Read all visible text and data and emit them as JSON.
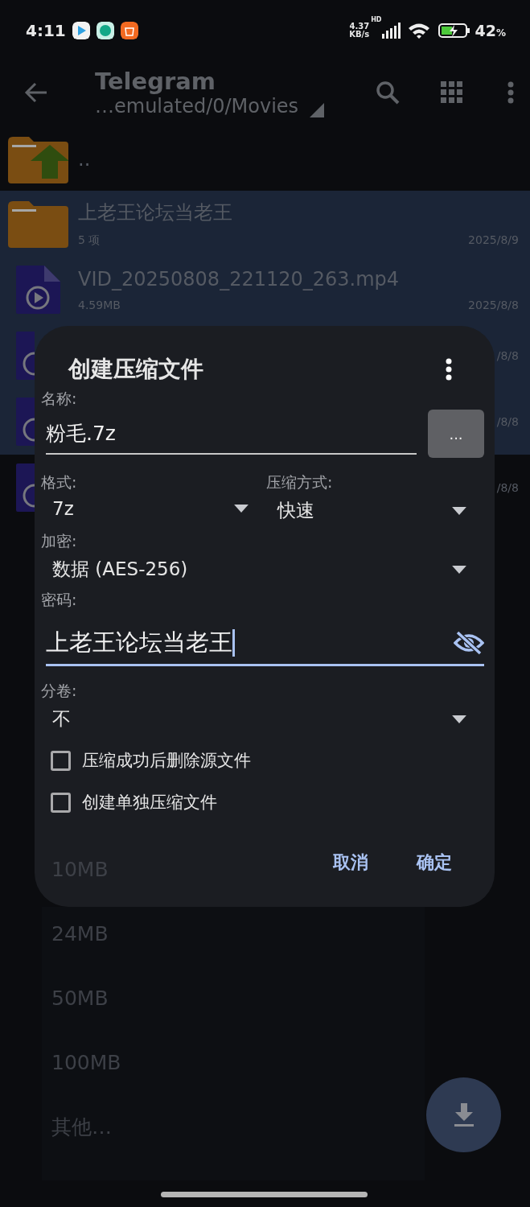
{
  "status_bar": {
    "time": "4:11",
    "net_speed": "4.37",
    "net_unit": "KB/s",
    "network_type": "HD",
    "battery": "42",
    "battery_unit": "%"
  },
  "toolbar": {
    "title": "Telegram",
    "path": "…emulated/0/Movies"
  },
  "files": [
    {
      "kind": "parent",
      "name": "..",
      "selected": false
    },
    {
      "kind": "folder",
      "name": "上老王论坛当老王",
      "info": "5 项",
      "date": "2025/8/9",
      "selected": true
    },
    {
      "kind": "video",
      "name": "VID_20250808_221120_263.mp4",
      "info": "4.59MB",
      "date": "2025/8/8",
      "selected": true
    },
    {
      "kind": "video",
      "date": "/8/8",
      "selected": true
    },
    {
      "kind": "video",
      "date": "/8/8",
      "selected": true
    },
    {
      "kind": "video",
      "date": "/8/8",
      "selected": false
    }
  ],
  "dialog": {
    "title": "创建压缩文件",
    "name_label": "名称:",
    "name_value": "粉毛.7z",
    "browse_button": "...",
    "format_label": "格式:",
    "format_value": "7z",
    "method_label": "压缩方式:",
    "method_value": "快速",
    "encryption_label": "加密:",
    "encryption_value": "数据 (AES-256)",
    "password_label": "密码:",
    "password_value": "上老王论坛当老王",
    "split_label": "分卷:",
    "split_value": "不",
    "options": [
      {
        "label": "压缩成功后删除源文件",
        "checked": false
      },
      {
        "label": "创建单独压缩文件",
        "checked": false
      }
    ],
    "buttons": [
      "取消",
      "确定"
    ]
  },
  "split_menu": [
    "10MB",
    "24MB",
    "50MB",
    "100MB",
    "其他…"
  ]
}
